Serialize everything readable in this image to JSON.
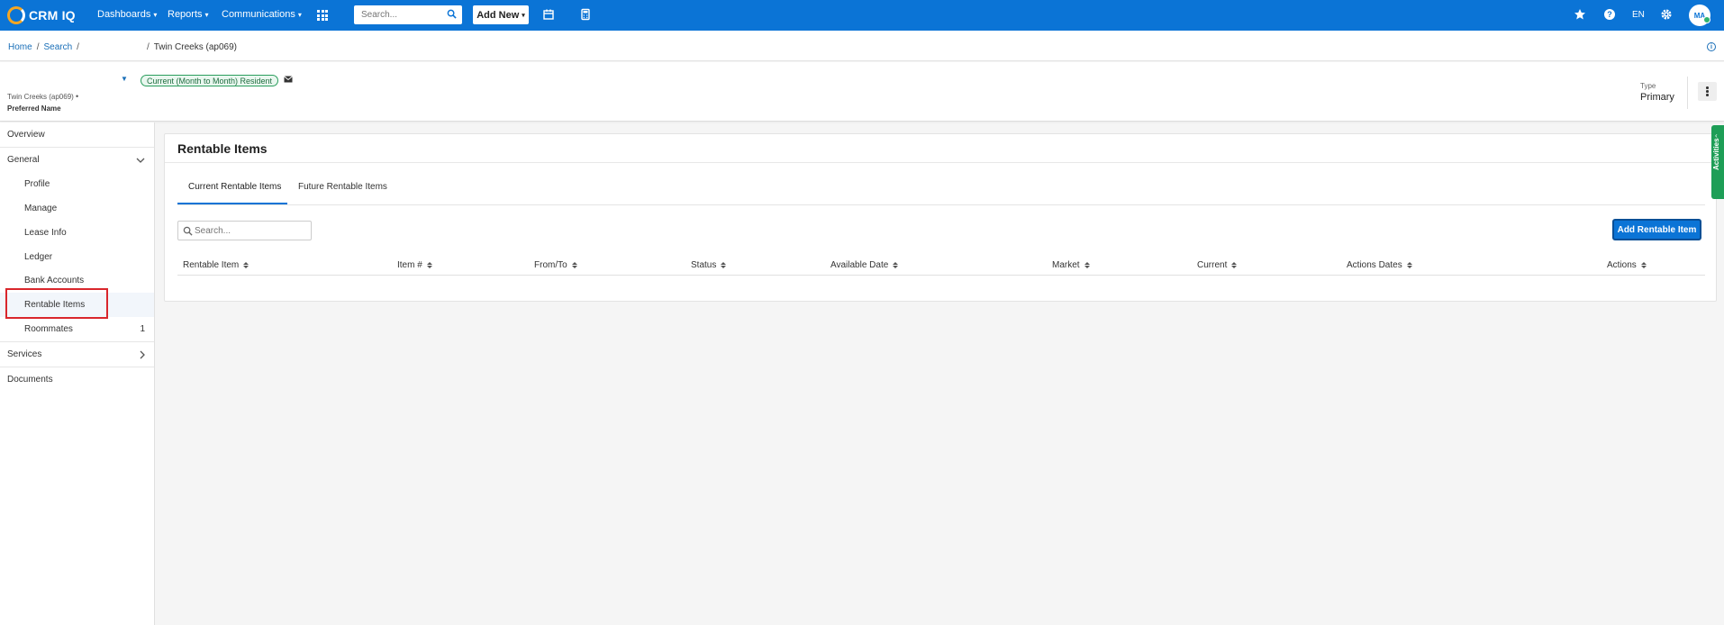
{
  "topnav": {
    "logo_text": "CRM IQ",
    "menus": [
      {
        "label": "Dashboards"
      },
      {
        "label": "Reports"
      },
      {
        "label": "Communications"
      }
    ],
    "search_placeholder": "Search...",
    "add_new_label": "Add New",
    "lang": "EN",
    "avatar_initials": "MA",
    "brand_color": "#0b74d6"
  },
  "breadcrumb": {
    "home": "Home",
    "search": "Search",
    "current": "Twin Creeks (ap069)"
  },
  "header": {
    "status": "Current (Month to Month) Resident",
    "property": "Twin Creeks (ap069)",
    "preferred_name": "Preferred Name",
    "type_label": "Type",
    "type_value": "Primary"
  },
  "sidebar": {
    "overview": "Overview",
    "general": "General",
    "items": [
      {
        "label": "Profile"
      },
      {
        "label": "Manage"
      },
      {
        "label": "Lease Info"
      },
      {
        "label": "Ledger"
      },
      {
        "label": "Bank Accounts"
      },
      {
        "label": "Rentable Items"
      },
      {
        "label": "Roommates",
        "count": "1"
      }
    ],
    "services": "Services",
    "documents": "Documents"
  },
  "main": {
    "title": "Rentable Items",
    "tabs": [
      {
        "label": "Current Rentable Items",
        "active": true
      },
      {
        "label": "Future Rentable Items",
        "active": false
      }
    ],
    "search_placeholder": "Search...",
    "add_button": "Add Rentable Item",
    "columns": [
      {
        "label": "Rentable Item"
      },
      {
        "label": "Item #"
      },
      {
        "label": "From/To"
      },
      {
        "label": "Status"
      },
      {
        "label": "Available Date"
      },
      {
        "label": "Market"
      },
      {
        "label": "Current"
      },
      {
        "label": "Actions Dates"
      },
      {
        "label": "Actions"
      }
    ]
  },
  "activities": {
    "label": "Activities",
    "color": "#1e9e57"
  }
}
